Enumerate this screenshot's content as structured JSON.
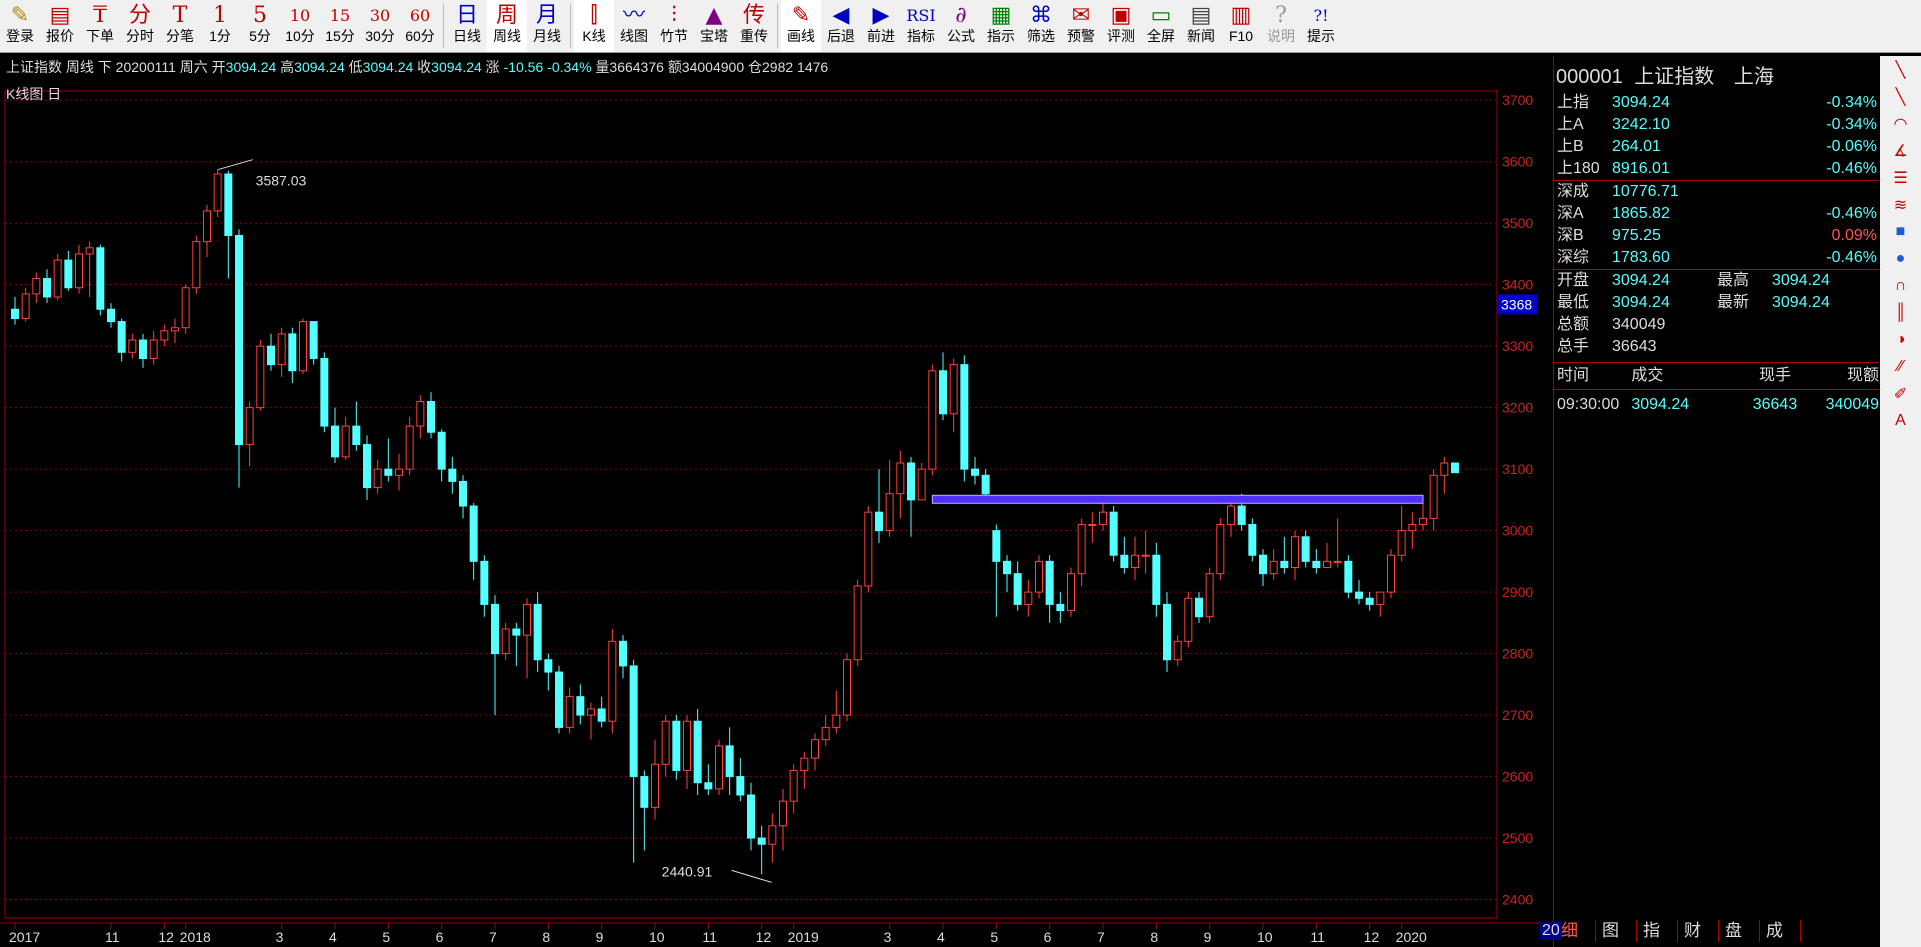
{
  "toolbar": [
    {
      "icon": "✎",
      "label": "登录",
      "name": "login",
      "color": "#b8860b"
    },
    {
      "icon": "▤",
      "label": "报价",
      "name": "quote",
      "color": "#c00000"
    },
    {
      "icon": "₸",
      "label": "下单",
      "name": "order",
      "color": "#c00000"
    },
    {
      "icon": "分",
      "label": "分时",
      "name": "timeshare",
      "color": "#c00000"
    },
    {
      "icon": "T",
      "label": "分笔",
      "name": "tick",
      "color": "#c00000"
    },
    {
      "icon": "1",
      "label": "1分",
      "name": "1min",
      "color": "#c00000"
    },
    {
      "icon": "5",
      "label": "5分",
      "name": "5min",
      "color": "#c00000"
    },
    {
      "icon": "10",
      "label": "10分",
      "name": "10min",
      "color": "#c00000"
    },
    {
      "icon": "15",
      "label": "15分",
      "name": "15min",
      "color": "#c00000"
    },
    {
      "icon": "30",
      "label": "30分",
      "name": "30min",
      "color": "#c00000"
    },
    {
      "icon": "60",
      "label": "60分",
      "name": "60min",
      "color": "#c00000"
    },
    {
      "icon": "日",
      "label": "日线",
      "name": "daily",
      "color": "#0000c0"
    },
    {
      "icon": "周",
      "label": "周线",
      "name": "weekly",
      "color": "#c00000",
      "active": true
    },
    {
      "icon": "月",
      "label": "月线",
      "name": "monthly",
      "color": "#0000c0"
    },
    {
      "icon": "⫿",
      "label": "K线",
      "name": "kline",
      "color": "#c00000",
      "active": true
    },
    {
      "icon": "〰",
      "label": "线图",
      "name": "linechart",
      "color": "#0000c0"
    },
    {
      "icon": "⫶",
      "label": "竹节",
      "name": "bamboo",
      "color": "#c00000"
    },
    {
      "icon": "▲",
      "label": "宝塔",
      "name": "tower",
      "color": "#800080"
    },
    {
      "icon": "传",
      "label": "重传",
      "name": "resend",
      "color": "#c00000"
    },
    {
      "icon": "✎",
      "label": "画线",
      "name": "draw",
      "color": "#c00000",
      "active": true
    },
    {
      "icon": "◀",
      "label": "后退",
      "name": "back",
      "color": "#0000c0"
    },
    {
      "icon": "▶",
      "label": "前进",
      "name": "forward",
      "color": "#0000c0"
    },
    {
      "icon": "RSI",
      "label": "指标",
      "name": "indicator",
      "color": "#0000c0"
    },
    {
      "icon": "∂",
      "label": "公式",
      "name": "formula",
      "color": "#800080"
    },
    {
      "icon": "▦",
      "label": "指示",
      "name": "hint",
      "color": "#008000"
    },
    {
      "icon": "⌘",
      "label": "筛选",
      "name": "filter",
      "color": "#0000c0"
    },
    {
      "icon": "✉",
      "label": "预警",
      "name": "alert",
      "color": "#c00000"
    },
    {
      "icon": "▣",
      "label": "评测",
      "name": "evaluate",
      "color": "#c00000"
    },
    {
      "icon": "▭",
      "label": "全屏",
      "name": "fullscreen",
      "color": "#008000"
    },
    {
      "icon": "▤",
      "label": "新闻",
      "name": "news",
      "color": "#444444"
    },
    {
      "icon": "▥",
      "label": "F10",
      "name": "f10",
      "color": "#c00000"
    },
    {
      "icon": "?",
      "label": "说明",
      "name": "help",
      "color": "#999999",
      "disabled": true
    },
    {
      "icon": "?!",
      "label": "提示",
      "name": "tips",
      "color": "#0000c0"
    }
  ],
  "infobar": {
    "name": "上证指数",
    "period": "周线",
    "dir": "下",
    "date": "20200111",
    "weekday": "周六",
    "open_l": "开",
    "open": "3094.24",
    "high_l": "高",
    "high": "3094.24",
    "low_l": "低",
    "low": "3094.24",
    "close_l": "收",
    "close": "3094.24",
    "chg_l": "涨",
    "chg": "-10.56",
    "pct": "-0.34%",
    "vol": "量3664376",
    "amt": "额34004900",
    "pos": "仓2982",
    "extra": "1476"
  },
  "chart_label": "K线图 日",
  "chart_data": {
    "type": "candlestick",
    "ylim": [
      2370,
      3715
    ],
    "yticks": [
      2400,
      2500,
      2600,
      2700,
      2800,
      2900,
      3000,
      3100,
      3200,
      3300,
      3400,
      3500,
      3600,
      3700
    ],
    "current_price_label": "3368",
    "current_price_value": 3368,
    "annotations": [
      {
        "text": "3587.03",
        "value": 3587.03
      },
      {
        "text": "2440.91",
        "value": 2440.91
      }
    ],
    "trend_line_value": 3051,
    "x_labels": [
      {
        "text": "2017",
        "week": 0
      },
      {
        "text": "11",
        "week": 9
      },
      {
        "text": "12",
        "week": 14
      },
      {
        "text": "2018",
        "week": 16
      },
      {
        "text": "3",
        "week": 25
      },
      {
        "text": "4",
        "week": 30
      },
      {
        "text": "5",
        "week": 35
      },
      {
        "text": "6",
        "week": 40
      },
      {
        "text": "7",
        "week": 45
      },
      {
        "text": "8",
        "week": 50
      },
      {
        "text": "9",
        "week": 55
      },
      {
        "text": "10",
        "week": 60
      },
      {
        "text": "11",
        "week": 65
      },
      {
        "text": "12",
        "week": 70
      },
      {
        "text": "2019",
        "week": 73
      },
      {
        "text": "3",
        "week": 82
      },
      {
        "text": "4",
        "week": 87
      },
      {
        "text": "5",
        "week": 92
      },
      {
        "text": "6",
        "week": 97
      },
      {
        "text": "7",
        "week": 102
      },
      {
        "text": "8",
        "week": 107
      },
      {
        "text": "9",
        "week": 112
      },
      {
        "text": "10",
        "week": 117
      },
      {
        "text": "11",
        "week": 122
      },
      {
        "text": "12",
        "week": 127
      },
      {
        "text": "2020",
        "week": 130
      }
    ],
    "trend_start_week": 86,
    "trend_end_week": 132,
    "candles": [
      [
        3360,
        3345,
        3380,
        3335
      ],
      [
        3345,
        3385,
        3395,
        3340
      ],
      [
        3385,
        3410,
        3420,
        3370
      ],
      [
        3410,
        3380,
        3425,
        3370
      ],
      [
        3380,
        3440,
        3450,
        3375
      ],
      [
        3440,
        3395,
        3455,
        3390
      ],
      [
        3395,
        3450,
        3465,
        3385
      ],
      [
        3450,
        3460,
        3470,
        3380
      ],
      [
        3460,
        3360,
        3465,
        3350
      ],
      [
        3360,
        3340,
        3370,
        3330
      ],
      [
        3340,
        3290,
        3345,
        3275
      ],
      [
        3290,
        3310,
        3320,
        3280
      ],
      [
        3310,
        3280,
        3320,
        3265
      ],
      [
        3280,
        3310,
        3325,
        3270
      ],
      [
        3310,
        3325,
        3335,
        3300
      ],
      [
        3325,
        3330,
        3345,
        3305
      ],
      [
        3330,
        3395,
        3400,
        3320
      ],
      [
        3395,
        3470,
        3480,
        3385
      ],
      [
        3470,
        3520,
        3530,
        3445
      ],
      [
        3520,
        3580,
        3587,
        3510
      ],
      [
        3580,
        3480,
        3585,
        3410
      ],
      [
        3480,
        3140,
        3490,
        3070
      ],
      [
        3140,
        3200,
        3210,
        3105
      ],
      [
        3200,
        3300,
        3310,
        3195
      ],
      [
        3300,
        3270,
        3320,
        3260
      ],
      [
        3270,
        3320,
        3330,
        3250
      ],
      [
        3320,
        3260,
        3330,
        3240
      ],
      [
        3260,
        3340,
        3345,
        3255
      ],
      [
        3340,
        3280,
        3340,
        3270
      ],
      [
        3280,
        3170,
        3290,
        3160
      ],
      [
        3170,
        3120,
        3200,
        3110
      ],
      [
        3120,
        3170,
        3185,
        3115
      ],
      [
        3170,
        3140,
        3210,
        3130
      ],
      [
        3140,
        3070,
        3155,
        3050
      ],
      [
        3070,
        3100,
        3115,
        3060
      ],
      [
        3100,
        3090,
        3150,
        3080
      ],
      [
        3090,
        3100,
        3125,
        3065
      ],
      [
        3100,
        3170,
        3185,
        3090
      ],
      [
        3170,
        3210,
        3220,
        3150
      ],
      [
        3210,
        3160,
        3225,
        3150
      ],
      [
        3160,
        3100,
        3165,
        3080
      ],
      [
        3100,
        3080,
        3120,
        3060
      ],
      [
        3080,
        3040,
        3090,
        3020
      ],
      [
        3040,
        2950,
        3045,
        2920
      ],
      [
        2950,
        2880,
        2960,
        2860
      ],
      [
        2880,
        2800,
        2895,
        2700
      ],
      [
        2800,
        2840,
        2850,
        2790
      ],
      [
        2840,
        2830,
        2850,
        2780
      ],
      [
        2830,
        2880,
        2890,
        2760
      ],
      [
        2880,
        2790,
        2900,
        2770
      ],
      [
        2790,
        2770,
        2800,
        2740
      ],
      [
        2770,
        2680,
        2780,
        2670
      ],
      [
        2680,
        2730,
        2745,
        2670
      ],
      [
        2730,
        2700,
        2750,
        2685
      ],
      [
        2700,
        2710,
        2720,
        2660
      ],
      [
        2710,
        2690,
        2730,
        2680
      ],
      [
        2690,
        2820,
        2840,
        2670
      ],
      [
        2820,
        2780,
        2830,
        2760
      ],
      [
        2780,
        2600,
        2790,
        2460
      ],
      [
        2600,
        2550,
        2610,
        2480
      ],
      [
        2550,
        2620,
        2660,
        2530
      ],
      [
        2620,
        2690,
        2700,
        2600
      ],
      [
        2690,
        2610,
        2700,
        2595
      ],
      [
        2610,
        2690,
        2700,
        2580
      ],
      [
        2690,
        2590,
        2710,
        2570
      ],
      [
        2590,
        2580,
        2620,
        2570
      ],
      [
        2580,
        2650,
        2660,
        2570
      ],
      [
        2650,
        2600,
        2680,
        2570
      ],
      [
        2600,
        2570,
        2630,
        2560
      ],
      [
        2570,
        2500,
        2590,
        2480
      ],
      [
        2500,
        2490,
        2520,
        2441
      ],
      [
        2490,
        2520,
        2540,
        2460
      ],
      [
        2520,
        2560,
        2580,
        2480
      ],
      [
        2560,
        2610,
        2620,
        2540
      ],
      [
        2610,
        2630,
        2640,
        2580
      ],
      [
        2630,
        2660,
        2670,
        2610
      ],
      [
        2660,
        2680,
        2700,
        2650
      ],
      [
        2680,
        2700,
        2740,
        2670
      ],
      [
        2700,
        2790,
        2800,
        2690
      ],
      [
        2790,
        2910,
        2920,
        2780
      ],
      [
        2910,
        3030,
        3040,
        2900
      ],
      [
        3030,
        3000,
        3100,
        2980
      ],
      [
        3000,
        3060,
        3115,
        2990
      ],
      [
        3060,
        3110,
        3130,
        3020
      ],
      [
        3110,
        3050,
        3120,
        2990
      ],
      [
        3050,
        3100,
        3110,
        3060
      ],
      [
        3100,
        3260,
        3270,
        3090
      ],
      [
        3260,
        3190,
        3290,
        3180
      ],
      [
        3190,
        3270,
        3280,
        3160
      ],
      [
        3270,
        3100,
        3285,
        3080
      ],
      [
        3100,
        3090,
        3120,
        3075
      ],
      [
        3090,
        3060,
        3100,
        3050
      ],
      [
        3000,
        2950,
        3010,
        2860
      ],
      [
        2950,
        2930,
        2960,
        2900
      ],
      [
        2930,
        2880,
        2950,
        2870
      ],
      [
        2880,
        2900,
        2920,
        2860
      ],
      [
        2900,
        2950,
        2960,
        2890
      ],
      [
        2950,
        2880,
        2960,
        2850
      ],
      [
        2880,
        2870,
        2900,
        2850
      ],
      [
        2870,
        2930,
        2940,
        2860
      ],
      [
        2930,
        3010,
        3020,
        2910
      ],
      [
        3010,
        3010,
        3030,
        2980
      ],
      [
        3010,
        3030,
        3045,
        3000
      ],
      [
        3030,
        2960,
        3040,
        2950
      ],
      [
        2960,
        2940,
        2990,
        2930
      ],
      [
        2940,
        2960,
        2990,
        2920
      ],
      [
        2960,
        2960,
        3000,
        2930
      ],
      [
        2960,
        2880,
        2980,
        2860
      ],
      [
        2880,
        2790,
        2900,
        2770
      ],
      [
        2790,
        2820,
        2830,
        2780
      ],
      [
        2820,
        2890,
        2900,
        2810
      ],
      [
        2890,
        2860,
        2900,
        2850
      ],
      [
        2860,
        2930,
        2940,
        2850
      ],
      [
        2930,
        3010,
        3020,
        2920
      ],
      [
        3010,
        3040,
        3050,
        2990
      ],
      [
        3040,
        3010,
        3060,
        3000
      ],
      [
        3010,
        2960,
        3020,
        2950
      ],
      [
        2960,
        2930,
        2970,
        2910
      ],
      [
        2930,
        2950,
        2970,
        2920
      ],
      [
        2950,
        2940,
        2990,
        2930
      ],
      [
        2940,
        2990,
        3000,
        2920
      ],
      [
        2990,
        2950,
        3000,
        2940
      ],
      [
        2950,
        2940,
        2970,
        2930
      ],
      [
        2940,
        2950,
        2980,
        2940
      ],
      [
        2950,
        2950,
        3020,
        2940
      ],
      [
        2950,
        2900,
        2960,
        2890
      ],
      [
        2900,
        2890,
        2920,
        2880
      ],
      [
        2890,
        2880,
        2900,
        2870
      ],
      [
        2880,
        2900,
        2900,
        2860
      ],
      [
        2900,
        2960,
        2970,
        2890
      ],
      [
        2960,
        3000,
        3040,
        2950
      ],
      [
        3000,
        3010,
        3030,
        2970
      ],
      [
        3010,
        3020,
        3050,
        3000
      ],
      [
        3020,
        3090,
        3100,
        3000
      ],
      [
        3090,
        3110,
        3120,
        3060
      ],
      [
        3110,
        3094.24,
        3110,
        3094.24
      ]
    ]
  },
  "right": {
    "title_code": "000001",
    "title_name": "上证指数",
    "title_mkt": "上海",
    "indices": [
      {
        "n": "上指",
        "p": "3094.24",
        "c": "-0.34%",
        "up": false
      },
      {
        "n": "上A",
        "p": "3242.10",
        "c": "-0.34%",
        "up": false
      },
      {
        "n": "上B",
        "p": "264.01",
        "c": "-0.06%",
        "up": false
      },
      {
        "n": "上180",
        "p": "8916.01",
        "c": "-0.46%",
        "up": false
      },
      {
        "n": "深成",
        "p": "10776.71",
        "c": "",
        "up": false
      },
      {
        "n": "深A",
        "p": "1865.82",
        "c": "-0.46%",
        "up": false
      },
      {
        "n": "深B",
        "p": "975.25",
        "c": "0.09%",
        "up": true
      },
      {
        "n": "深综",
        "p": "1783.60",
        "c": "-0.46%",
        "up": false
      }
    ],
    "open_l": "开盘",
    "open": "3094.24",
    "high_l": "最高",
    "high": "3094.24",
    "low_l": "最低",
    "low": "3094.24",
    "last_l": "最新",
    "last": "3094.24",
    "amt_l": "总额",
    "amt": "340049",
    "vol_l": "总手",
    "vol": "36643",
    "tick_heads": [
      "时间",
      "成交",
      "现手",
      "现额"
    ],
    "tick": {
      "time": "09:30:00",
      "price": "3094.24",
      "vol": "36643",
      "amt": "340049"
    }
  },
  "tools": [
    "╲",
    "╲",
    "◠",
    "∡",
    "☰",
    "≋",
    "■",
    "●",
    "∩",
    "║",
    "◑",
    "⁄⁄",
    "✐",
    "A"
  ],
  "bottom_tabs": [
    {
      "t": "细",
      "on": true
    },
    {
      "t": "图"
    },
    {
      "t": "指"
    },
    {
      "t": "财"
    },
    {
      "t": "盘"
    },
    {
      "t": "成"
    }
  ],
  "bottom_num": "20"
}
